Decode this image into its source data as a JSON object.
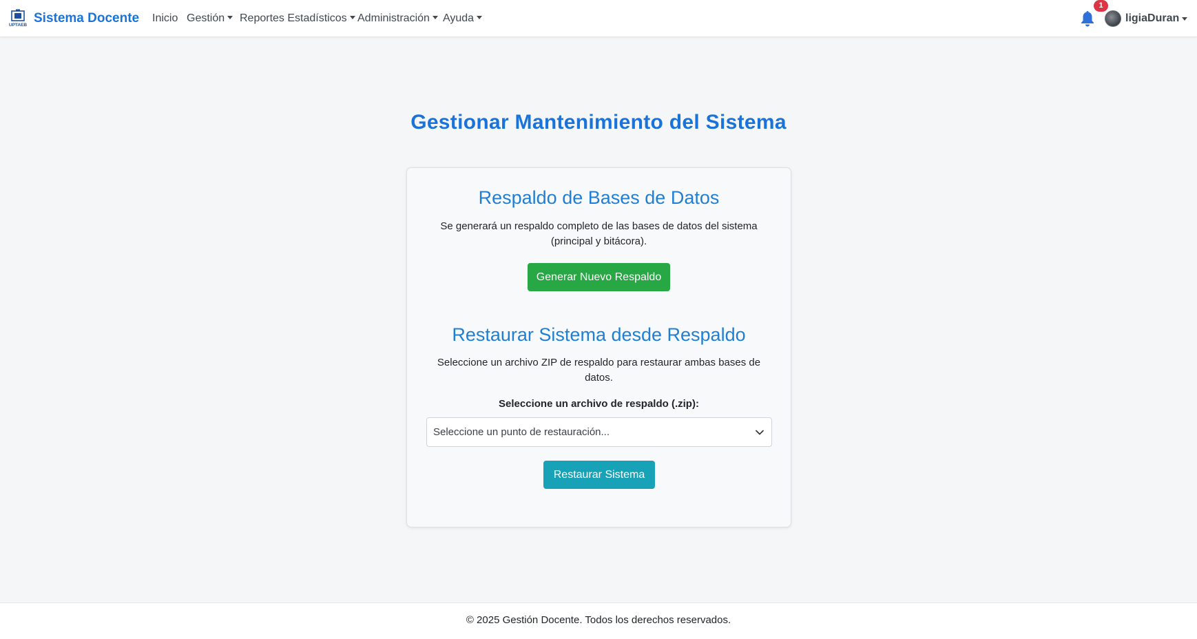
{
  "navbar": {
    "brand_logo_text": "UPTAEB",
    "brand": "Sistema Docente",
    "items": [
      {
        "label": "Inicio",
        "dropdown": false
      },
      {
        "label": "Gestión",
        "dropdown": true
      },
      {
        "label": "Reportes Estadísticos",
        "dropdown": true
      },
      {
        "label": "Administración",
        "dropdown": true
      },
      {
        "label": "Ayuda",
        "dropdown": true
      }
    ],
    "notifications": {
      "icon": "bell-icon",
      "count": "1"
    },
    "user": {
      "name": "ligiaDuran",
      "icon": "avatar"
    }
  },
  "main": {
    "title": "Gestionar Mantenimiento del Sistema",
    "backup": {
      "title": "Respaldo de Bases de Datos",
      "description": "Se generará un respaldo completo de las bases de datos del sistema (principal y bitácora).",
      "button": "Generar Nuevo Respaldo"
    },
    "restore": {
      "title": "Restaurar Sistema desde Respaldo",
      "description": "Seleccione un archivo ZIP de respaldo para restaurar ambas bases de datos.",
      "field_label": "Seleccione un archivo de respaldo (.zip):",
      "select_value": "Seleccione un punto de restauración...",
      "button": "Restaurar Sistema"
    }
  },
  "footer": {
    "text": "© 2025 Gestión Docente. Todos los derechos reservados."
  },
  "colors": {
    "brand": "#1a73d9",
    "success": "#28a745",
    "info": "#17a2b8",
    "badge": "#dc3545"
  }
}
